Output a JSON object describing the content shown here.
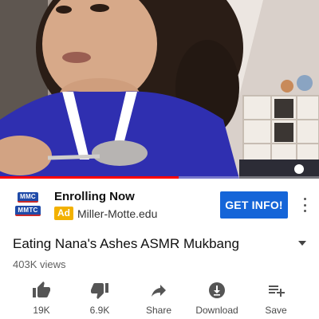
{
  "player": {
    "progress_fraction": 0.56
  },
  "ad": {
    "logo_lines": [
      "MMC",
      "MMTC"
    ],
    "title": "Enrolling Now",
    "tag": "Ad",
    "domain": "Miller-Motte.edu",
    "cta_label": "GET INFO!",
    "cta_color": "#1565d8",
    "tag_color": "#f2b100"
  },
  "video": {
    "title": "Eating Nana's Ashes ASMR Mukbang",
    "views": "403K views"
  },
  "actions": [
    {
      "icon": "thumbs-up-icon",
      "label": "19K"
    },
    {
      "icon": "thumbs-down-icon",
      "label": "6.9K"
    },
    {
      "icon": "share-icon",
      "label": "Share"
    },
    {
      "icon": "download-icon",
      "label": "Download"
    },
    {
      "icon": "playlist-add-icon",
      "label": "Save"
    }
  ],
  "colors": {
    "progress": "#ff0000"
  }
}
